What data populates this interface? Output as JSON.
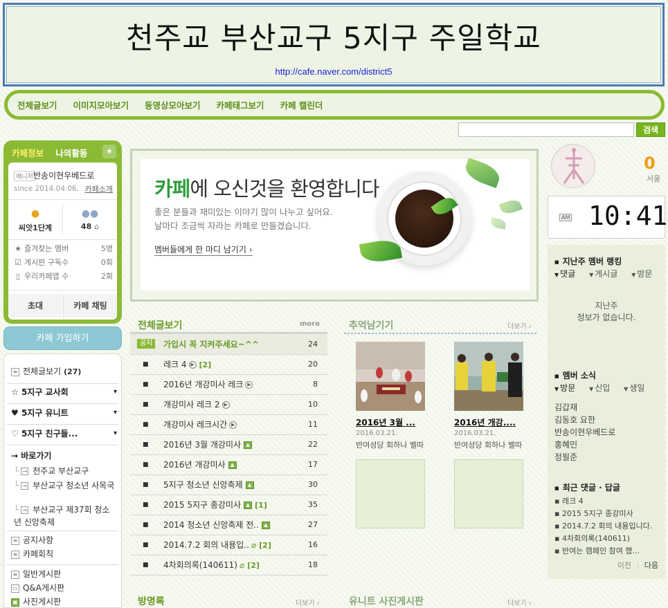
{
  "header": {
    "title": "천주교 부산교구 5지구 주일학교",
    "url": "http://cafe.naver.com/district5"
  },
  "menubar": {
    "items": [
      "전체글보기",
      "이미지모아보기",
      "동영상모아보기",
      "카페태그보기",
      "카페 캘린더"
    ]
  },
  "search": {
    "placeholder": "",
    "button": "검색"
  },
  "profile": {
    "tab_info": "카페정보",
    "tab_activity": "나의활동",
    "manager_badge": "매니저",
    "manager_name": "반송이현우베드로",
    "since": "since 2014.04.06.",
    "intro_link": "카페소개",
    "rank": "씨앗1단계",
    "members": "48",
    "rows": [
      {
        "icon": "star-icon",
        "label": "즐겨찾는 멤버",
        "value": "5명"
      },
      {
        "icon": "checkbox-icon",
        "label": "게시판 구독수",
        "value": "0회"
      },
      {
        "icon": "mobile-icon",
        "label": "우리카페앱 수",
        "value": "2회"
      }
    ],
    "invite": "초대",
    "chat": "카페 채팅"
  },
  "join_button": "카페 가입하기",
  "leftmenu": {
    "all_posts": "전체글보기",
    "all_posts_count": "(27)",
    "groups": [
      "5지구 교사회",
      "5지구 유니트",
      "5지구 친구들..."
    ],
    "goto_title": "→ 바로가기",
    "goto_items": [
      "천주교 부산교구",
      "부산교구 청소년 사목국",
      "부산교구 제37회 청소년 신앙축제"
    ],
    "boards_a": [
      "공지사항",
      "카페회칙"
    ],
    "boards_b": [
      "일반게시판",
      "Q&A게시판",
      "사진게시판"
    ]
  },
  "welcome": {
    "title_highlight": "카페",
    "title_rest": "에 오신것을 환영합니다",
    "sub1": "좋은 분들과 재미있는 이야기 많이 나누고 싶어요.",
    "sub2": "날마다 조금씩 자라는 카페로 만들겠습니다.",
    "link": "멤버들에게 한 마디 남기기 ›"
  },
  "articles": {
    "title": "전체글보기",
    "more": "more",
    "notice_badge": "공지",
    "notice": {
      "title": "가입시 꼭 지켜주세요~^^",
      "count": "24"
    },
    "rows": [
      {
        "title": "레크 4",
        "icon": "play",
        "comments": "[2]",
        "count": "20"
      },
      {
        "title": "2016년 개강미사 레크",
        "icon": "play",
        "comments": "",
        "count": "8"
      },
      {
        "title": "개강미사 레크 2",
        "icon": "play",
        "comments": "",
        "count": "10"
      },
      {
        "title": "개강미사 레크시간",
        "icon": "play",
        "comments": "",
        "count": "11"
      },
      {
        "title": "2016년 3월 개강미사",
        "icon": "image",
        "comments": "",
        "count": "22"
      },
      {
        "title": "2016년 개강미사",
        "icon": "image",
        "comments": "",
        "count": "17"
      },
      {
        "title": "5지구 청소년 신앙축제",
        "icon": "image",
        "comments": "",
        "count": "30"
      },
      {
        "title": "2015 5지구 종강미사",
        "icon": "image",
        "comments": "[1]",
        "count": "35"
      },
      {
        "title": "2014 청소년 신앙축제 전..",
        "icon": "image",
        "comments": "",
        "count": "27"
      },
      {
        "title": "2014.7.2 회의 내용입..",
        "icon": "clip",
        "comments": "[2]",
        "count": "16"
      },
      {
        "title": "4차회의록(140611)",
        "icon": "clip",
        "comments": "[2]",
        "count": "18"
      }
    ]
  },
  "memories": {
    "title": "추억남기기",
    "more": "더보기 ›",
    "photos": [
      {
        "caption": "2016년 3월 ...",
        "date": "2016.03.21.",
        "author": "반여성당 회하나 벨따"
      },
      {
        "caption": "2016년 개강....",
        "date": "2016.03.21.",
        "author": "반여성당 회하나 벨따"
      }
    ]
  },
  "guestbook": {
    "title": "방명록",
    "more": "더보기 ›"
  },
  "unit_photos": {
    "title": "유니트 사진게시판",
    "more": "더보기 ›"
  },
  "right": {
    "count": "0",
    "count_label": "서울",
    "clock_ampm": "AM",
    "clock_time": "10:41",
    "ranking": {
      "title": "지난주 멤버 랭킹",
      "tabs": [
        "댓글",
        "게시글",
        "방문"
      ],
      "empty1": "지난주",
      "empty2": "정보가 없습니다."
    },
    "news": {
      "title": "멤버 소식",
      "tabs": [
        "방문",
        "신입",
        "생일"
      ],
      "members": [
        "김갑재",
        "김동호 요한",
        "반송이현우베드로",
        "홍혜민",
        "정필준"
      ]
    },
    "recent": {
      "title": "최근 댓글 · 답글",
      "items": [
        "레크 4",
        "2015 5지구 종강미사",
        "2014.7.2 회의 내용입니다.",
        "4차회의록(140611)",
        "반여는 캠페인 참여 했..."
      ],
      "prev": "이전",
      "next": "다음"
    }
  }
}
